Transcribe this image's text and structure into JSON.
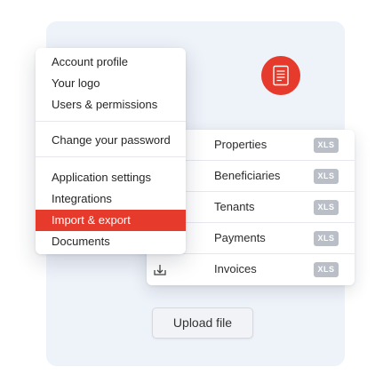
{
  "colors": {
    "accent": "#e53a2c",
    "background_card": "#eef2f9",
    "xls_badge": "#b9bec7"
  },
  "header_icon": "document-icon",
  "menu": {
    "groups": [
      [
        "Account profile",
        "Your logo",
        "Users & permissions"
      ],
      [
        "Change your password"
      ],
      [
        "Application settings",
        "Integrations",
        "Import & export",
        "Documents"
      ]
    ],
    "active_item": "Import & export"
  },
  "import_panel": {
    "rows": [
      {
        "label": "Properties",
        "badge": "XLS"
      },
      {
        "label": "Beneficiaries",
        "badge": "XLS"
      },
      {
        "label": "Tenants",
        "badge": "XLS"
      },
      {
        "label": "Payments",
        "badge": "XLS"
      },
      {
        "label": "Invoices",
        "badge": "XLS",
        "icon": "upload-tray-icon"
      }
    ]
  },
  "upload_button": {
    "label": "Upload file"
  }
}
